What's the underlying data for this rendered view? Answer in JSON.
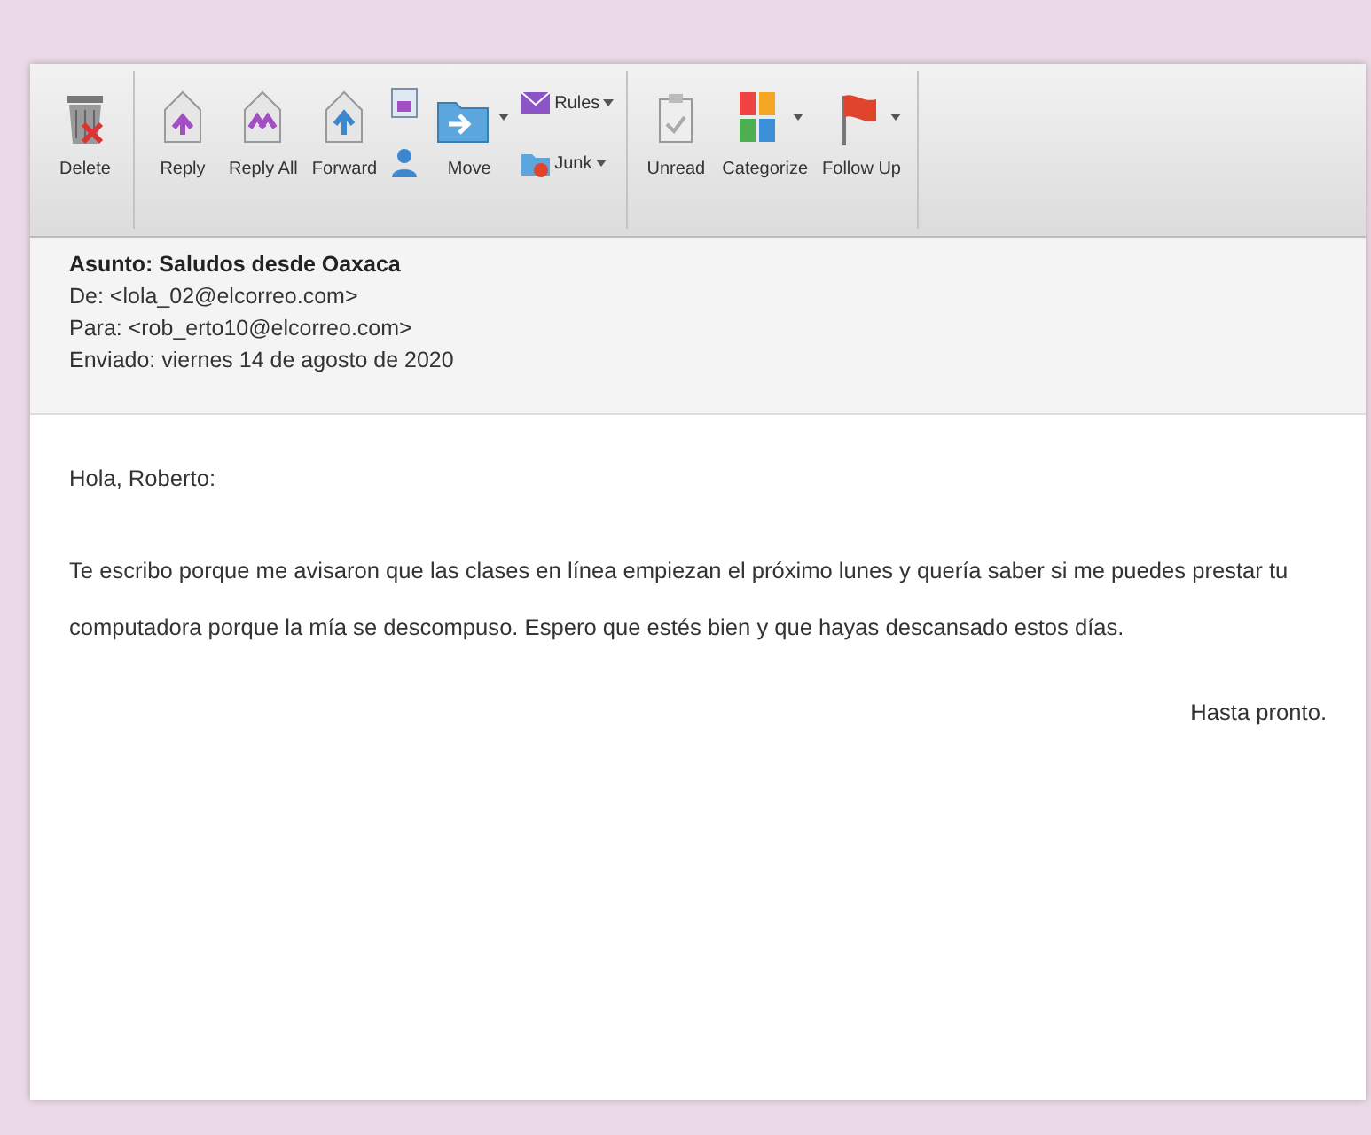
{
  "toolbar": {
    "groups": [
      {
        "items": [
          {
            "kind": "large",
            "label": "Delete",
            "menu": false
          }
        ]
      },
      {
        "items": [
          {
            "kind": "large",
            "label": "Reply",
            "menu": false
          },
          {
            "kind": "large",
            "label": "Reply All",
            "menu": false
          },
          {
            "kind": "large",
            "label": "Forward",
            "menu": false
          },
          {
            "kind": "icon-stack"
          },
          {
            "kind": "large",
            "label": "Move",
            "menu": true
          },
          {
            "kind": "stack",
            "entries": [
              {
                "label": "Rules",
                "menu": true
              },
              {
                "label": "Junk",
                "menu": true
              }
            ]
          }
        ]
      },
      {
        "items": [
          {
            "kind": "large",
            "label": "Unread",
            "menu": false
          },
          {
            "kind": "large",
            "label": "Categorize",
            "menu": true
          },
          {
            "kind": "large",
            "label": "Follow Up",
            "menu": true
          }
        ]
      }
    ]
  },
  "header": {
    "subject": "Asunto: Saludos desde Oaxaca",
    "from": "De: <lola_02@elcorreo.com>",
    "to": "Para: <rob_erto10@elcorreo.com>",
    "sent": "Enviado: viernes 14 de agosto de 2020"
  },
  "body": {
    "greeting": "Hola, Roberto:",
    "paragraph": "Te escribo porque me avisaron que las clases en línea empiezan el próximo lunes y quería saber si me puedes prestar tu computadora porque la mía se descompuso. Espero que estés  bien y que hayas descansado estos días.",
    "closing": "Hasta pronto."
  }
}
